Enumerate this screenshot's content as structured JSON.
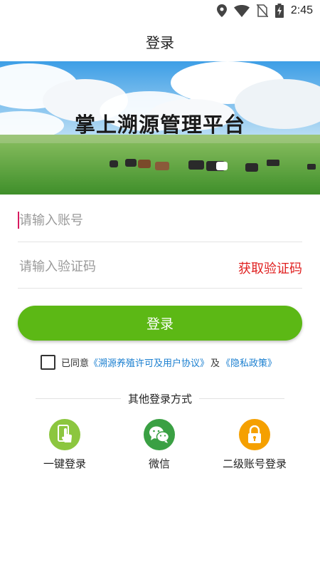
{
  "status_bar": {
    "time": "2:45",
    "icons": [
      "location-icon",
      "wifi-icon",
      "no-sim-icon",
      "battery-charging-icon"
    ]
  },
  "header": {
    "title": "登录"
  },
  "banner": {
    "title": "掌上溯源管理平台"
  },
  "form": {
    "account_placeholder": "请输入账号",
    "code_placeholder": "请输入验证码",
    "get_code_label": "获取验证码",
    "login_label": "登录"
  },
  "agreement": {
    "prefix": "已同意",
    "license_link": "《溯源养殖许可及用户协议》",
    "conjunction": "及",
    "privacy_link": "《隐私政策》",
    "checked": false
  },
  "other_login": {
    "title": "其他登录方式",
    "methods": [
      {
        "label": "一键登录",
        "icon": "tap-phone-icon",
        "color": "#8cc63f"
      },
      {
        "label": "微信",
        "icon": "wechat-icon",
        "color": "#3aa043"
      },
      {
        "label": "二级账号登录",
        "icon": "lock-icon",
        "color": "#f5a000"
      }
    ]
  },
  "colors": {
    "primary_green": "#5cb815",
    "link_blue": "#1a7fd0",
    "get_code_red": "#e02020"
  }
}
